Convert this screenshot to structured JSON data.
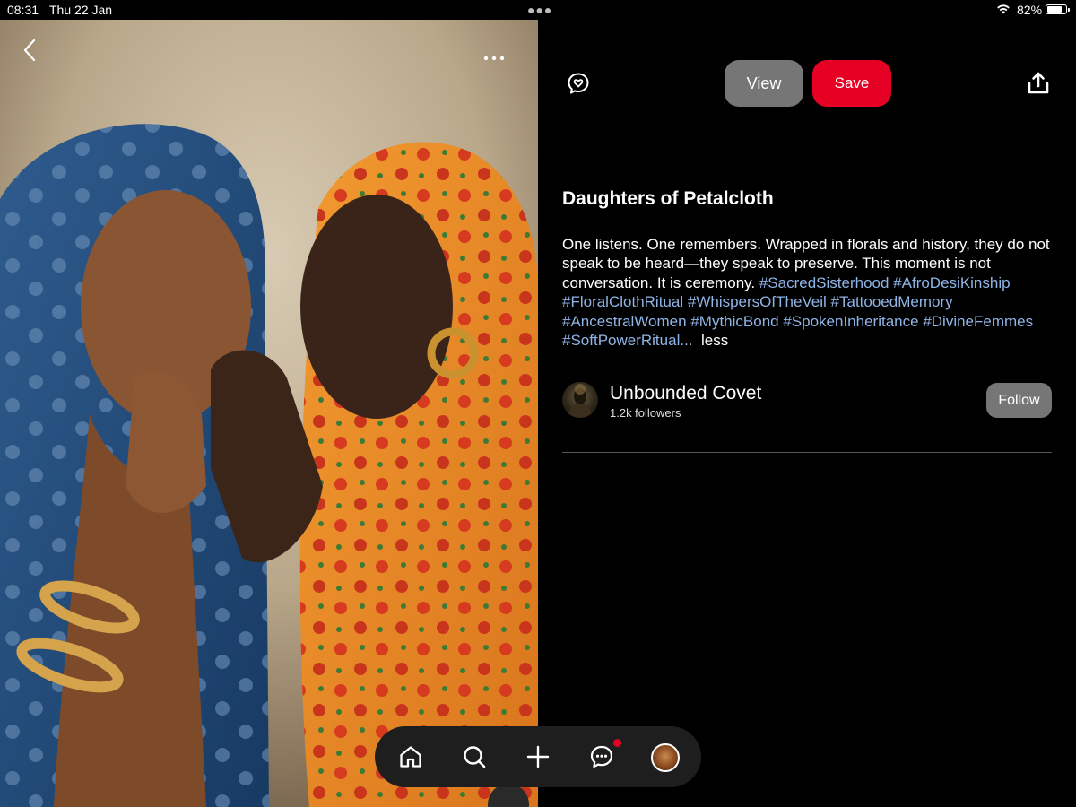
{
  "status_bar": {
    "time": "08:31",
    "date": "Thu 22 Jan",
    "battery": "82%",
    "battery_level": 0.82
  },
  "pin": {
    "title": "Daughters of Petalcloth",
    "description_text": "One listens. One remembers. Wrapped in florals and history, they do not speak to be heard—they speak to preserve. This moment is not conversation. It is ceremony. ",
    "hashtags": [
      "#SacredSisterhood",
      "#AfroDesiKinship",
      "#FloralClothRitual",
      "#WhispersOfTheVeil",
      "#TattooedMemory",
      "#AncestralWomen",
      "#MythicBond",
      "#SpokenInheritance",
      "#DivineFemmes",
      "#SoftPowerRitual"
    ],
    "ellipsis": "...",
    "less_label": "less"
  },
  "actions": {
    "view_label": "View",
    "save_label": "Save"
  },
  "creator": {
    "name": "Unbounded Covet",
    "followers": "1.2k followers",
    "follow_label": "Follow"
  },
  "icons": {
    "back": "chevron-left-icon",
    "more": "more-horizontal-icon",
    "reaction": "reaction-heart-icon",
    "share": "share-icon",
    "home": "home-icon",
    "search": "search-icon",
    "create": "plus-icon",
    "messages": "messages-icon",
    "profile": "profile-avatar"
  },
  "colors": {
    "save_red": "#e60023",
    "hashtag_blue": "#8fb4e6",
    "button_gray": "#767676",
    "nav_bg": "#1e1e1e"
  }
}
